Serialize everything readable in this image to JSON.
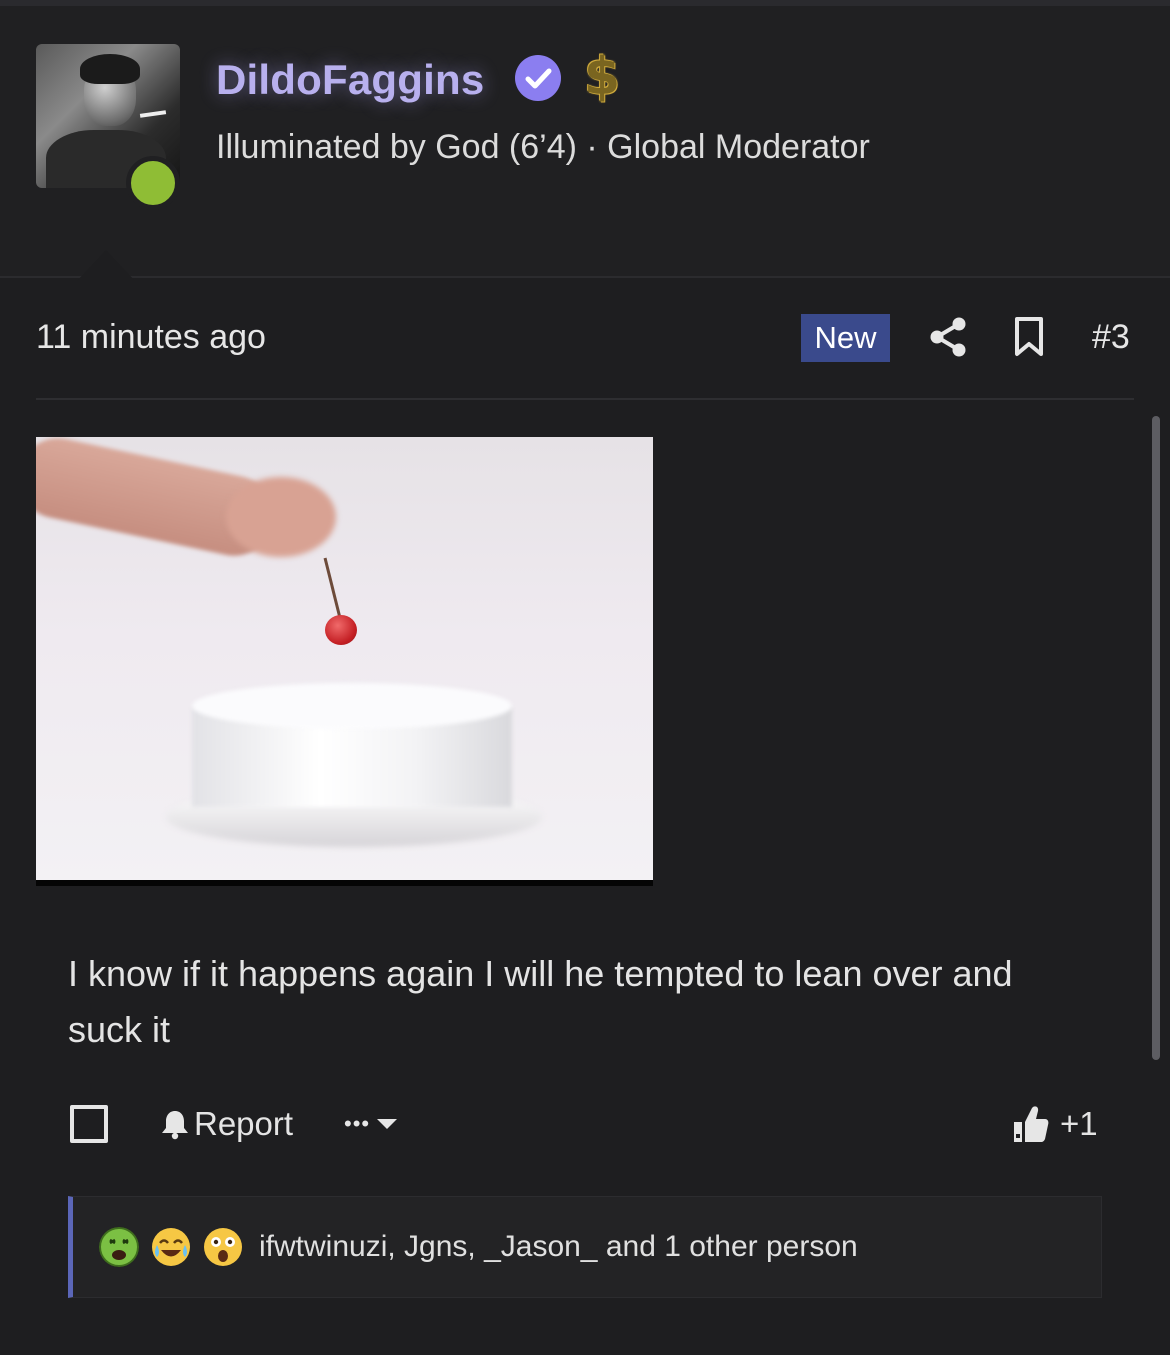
{
  "post_header": {
    "username": "DildoFaggins",
    "user_title": "Illuminated by God (6’4) · Global Moderator",
    "verified_icon": "verified-badge-icon",
    "donor_icon": "dollar-sign-icon",
    "dollar_glyph": "$",
    "online_status": "online",
    "colors": {
      "username": "#b8b0ee",
      "verified": "#8b7ef0",
      "online": "#8fbd35"
    }
  },
  "post_meta": {
    "timestamp": "11 minutes ago",
    "new_badge": "New",
    "post_number": "#3",
    "icons": [
      "share-icon",
      "bookmark-icon"
    ]
  },
  "post_body": {
    "text": "I know if it happens again I will he tempted to lean over and suck it"
  },
  "post_actions": {
    "report_label": "Report",
    "more_label": "•••",
    "like_count": "+1",
    "icons": [
      "checkbox-icon",
      "bell-icon",
      "caret-down-icon",
      "thumbs-up-icon"
    ]
  },
  "reactions": {
    "emojis": [
      "sick-face-emoji",
      "crying-laughing-emoji",
      "astonished-face-emoji"
    ],
    "summary": "ifwtwinuzi, Jgns, _Jason_ and 1 other person"
  }
}
